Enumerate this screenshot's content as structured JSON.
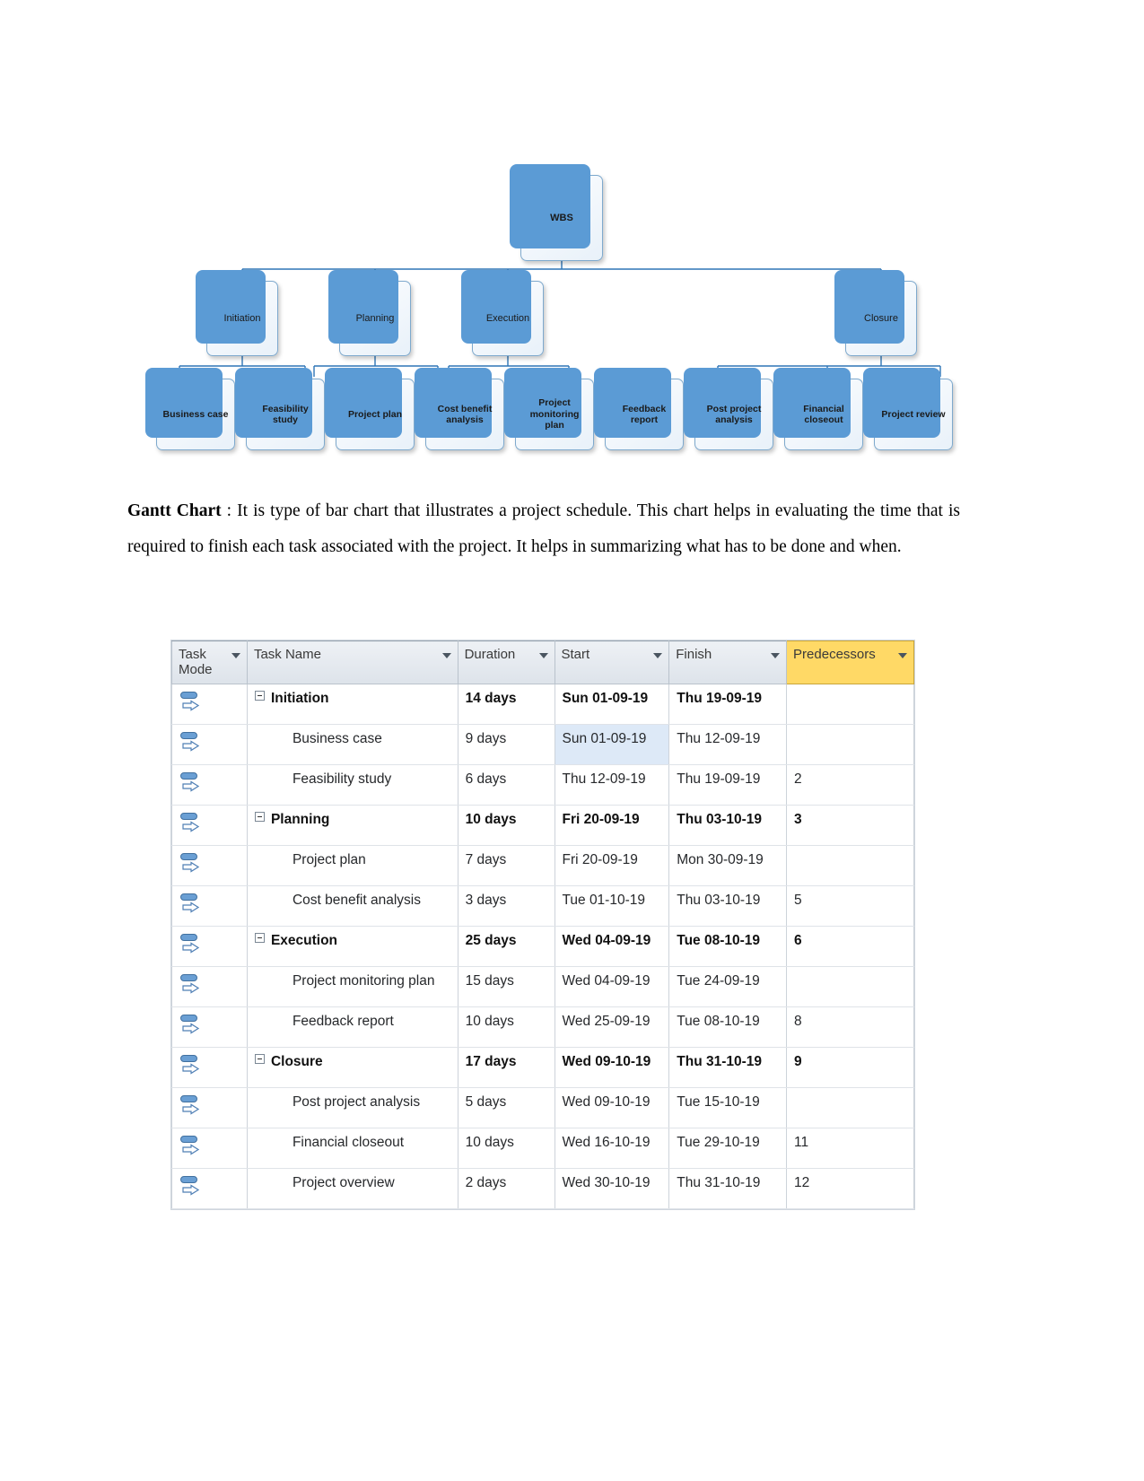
{
  "wbs": {
    "root": {
      "label": "WBS"
    },
    "level2": [
      {
        "label": "Initiation"
      },
      {
        "label": "Planning"
      },
      {
        "label": "Execution"
      },
      {
        "label": "Closure"
      }
    ],
    "level3": [
      {
        "label": "Business case"
      },
      {
        "label": "Feasibility study"
      },
      {
        "label": "Project plan"
      },
      {
        "label": "Cost benefit analysis"
      },
      {
        "label": "Project monitoring plan"
      },
      {
        "label": "Feedback report"
      },
      {
        "label": "Post project analysis"
      },
      {
        "label": "Financial closeout"
      },
      {
        "label": "Project review"
      }
    ],
    "node_color": "#5b9bd5",
    "card_color": "#f2f7fc",
    "connector_color": "#2e75b6"
  },
  "paragraph": {
    "heading": "Gantt Chart",
    "separator": " : ",
    "body": "It is type of bar chart that illustrates a project schedule. This chart helps in evaluating the time that is required to finish each task associated with the project. It helps in summarizing what has to be done and when."
  },
  "gantt": {
    "accent_header_color": "#ffd966",
    "selected_cell_color": "#dde9f7",
    "columns": [
      {
        "key": "mode",
        "label": "Task\nMode",
        "has_filter": true,
        "highlighted": false
      },
      {
        "key": "name",
        "label": "Task Name",
        "has_filter": true,
        "highlighted": false
      },
      {
        "key": "dur",
        "label": "Duration",
        "has_filter": true,
        "highlighted": false
      },
      {
        "key": "start",
        "label": "Start",
        "has_filter": true,
        "highlighted": false
      },
      {
        "key": "fin",
        "label": "Finish",
        "has_filter": true,
        "highlighted": false
      },
      {
        "key": "pred",
        "label": "Predecessors",
        "has_filter": true,
        "highlighted": true
      }
    ],
    "rows": [
      {
        "name": "Initiation",
        "duration": "14 days",
        "start": "Sun 01-09-19",
        "finish": "Thu 19-09-19",
        "predecessors": "",
        "summary": true,
        "selected_start": false
      },
      {
        "name": "Business case",
        "duration": "9 days",
        "start": "Sun 01-09-19",
        "finish": "Thu 12-09-19",
        "predecessors": "",
        "summary": false,
        "selected_start": true
      },
      {
        "name": "Feasibility study",
        "duration": "6 days",
        "start": "Thu 12-09-19",
        "finish": "Thu 19-09-19",
        "predecessors": "2",
        "summary": false,
        "selected_start": false
      },
      {
        "name": "Planning",
        "duration": "10 days",
        "start": "Fri 20-09-19",
        "finish": "Thu 03-10-19",
        "predecessors": "3",
        "summary": true,
        "selected_start": false
      },
      {
        "name": "Project plan",
        "duration": "7 days",
        "start": "Fri 20-09-19",
        "finish": "Mon 30-09-19",
        "predecessors": "",
        "summary": false,
        "selected_start": false
      },
      {
        "name": "Cost benefit analysis",
        "duration": "3 days",
        "start": "Tue 01-10-19",
        "finish": "Thu 03-10-19",
        "predecessors": "5",
        "summary": false,
        "selected_start": false
      },
      {
        "name": "Execution",
        "duration": "25 days",
        "start": "Wed 04-09-19",
        "finish": "Tue 08-10-19",
        "predecessors": "6",
        "summary": true,
        "selected_start": false
      },
      {
        "name": "Project monitoring plan",
        "duration": "15 days",
        "start": "Wed 04-09-19",
        "finish": "Tue 24-09-19",
        "predecessors": "",
        "summary": false,
        "selected_start": false
      },
      {
        "name": "Feedback report",
        "duration": "10 days",
        "start": "Wed 25-09-19",
        "finish": "Tue 08-10-19",
        "predecessors": "8",
        "summary": false,
        "selected_start": false
      },
      {
        "name": "Closure",
        "duration": "17 days",
        "start": "Wed 09-10-19",
        "finish": "Thu 31-10-19",
        "predecessors": "9",
        "summary": true,
        "selected_start": false
      },
      {
        "name": "Post project analysis",
        "duration": "5 days",
        "start": "Wed 09-10-19",
        "finish": "Tue 15-10-19",
        "predecessors": "",
        "summary": false,
        "selected_start": false
      },
      {
        "name": "Financial closeout",
        "duration": "10 days",
        "start": "Wed 16-10-19",
        "finish": "Tue 29-10-19",
        "predecessors": "11",
        "summary": false,
        "selected_start": false
      },
      {
        "name": "Project overview",
        "duration": "2 days",
        "start": "Wed 30-10-19",
        "finish": "Thu 31-10-19",
        "predecessors": "12",
        "summary": false,
        "selected_start": false
      }
    ]
  }
}
